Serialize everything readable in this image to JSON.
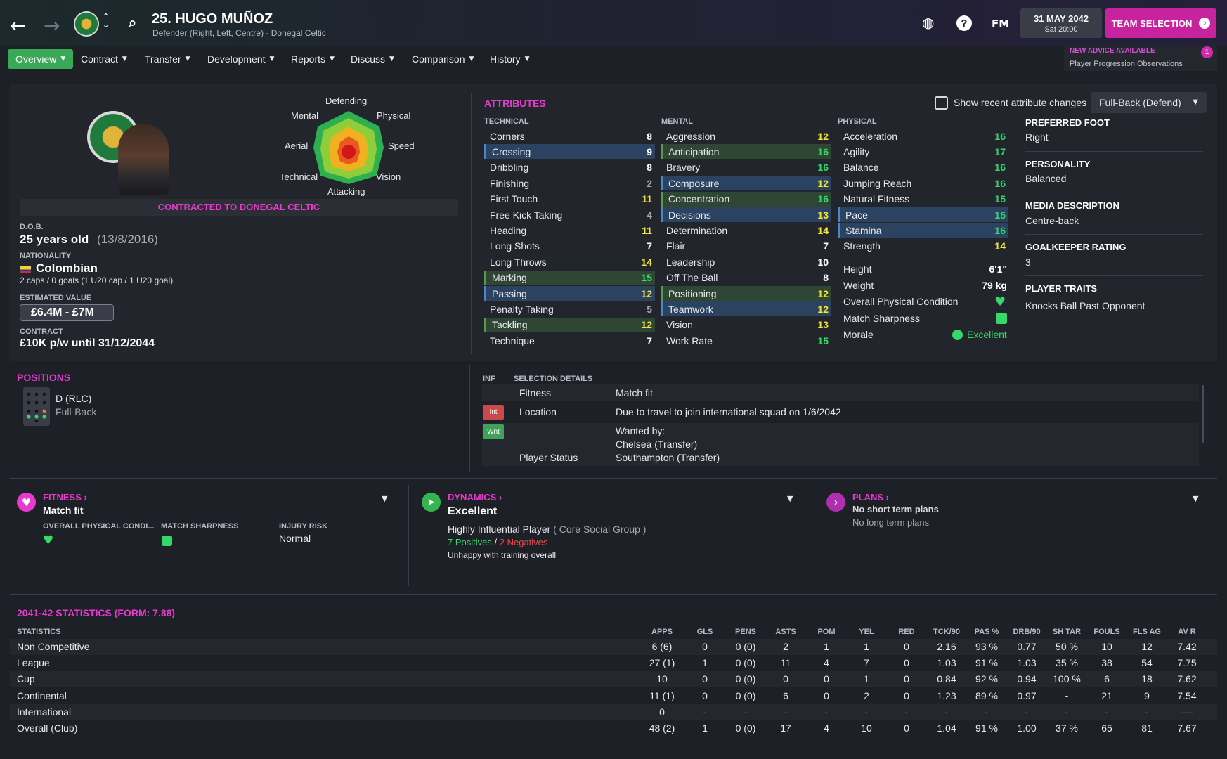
{
  "header": {
    "title": "25. HUGO MUÑOZ",
    "subtitle": "Defender (Right, Left, Centre) - Donegal Celtic",
    "fm_label": "FM",
    "date_main": "31 MAY 2042",
    "date_sub": "Sat 20:00",
    "team_selection": "TEAM SELECTION"
  },
  "tabs": [
    "Overview",
    "Contract",
    "Transfer",
    "Development",
    "Reports",
    "Discuss",
    "Comparison",
    "History"
  ],
  "advice": {
    "title": "NEW ADVICE AVAILABLE",
    "subtitle": "Player Progression Observations",
    "count": "1"
  },
  "profile": {
    "contracted": "CONTRACTED TO DONEGAL CELTIC",
    "dob_label": "D.O.B.",
    "dob_age": "25 years old",
    "dob_date": "(13/8/2016)",
    "nationality_label": "NATIONALITY",
    "nationality": "Colombian",
    "caps": "2 caps / 0 goals (1 U20 cap / 1 U20 goal)",
    "value_label": "ESTIMATED VALUE",
    "value": "£6.4M - £7M",
    "contract_label": "CONTRACT",
    "contract": "£10K p/w until 31/12/2044"
  },
  "radar": {
    "labels": [
      "Defending",
      "Physical",
      "Speed",
      "Vision",
      "Attacking",
      "Technical",
      "Aerial",
      "Mental"
    ]
  },
  "attributes": {
    "title": "ATTRIBUTES",
    "show_changes": "Show recent attribute changes",
    "role": "Full-Back (Defend)",
    "technical_label": "TECHNICAL",
    "mental_label": "MENTAL",
    "physical_label": "PHYSICAL",
    "technical": [
      {
        "name": "Corners",
        "value": "8"
      },
      {
        "name": "Crossing",
        "value": "9"
      },
      {
        "name": "Dribbling",
        "value": "8"
      },
      {
        "name": "Finishing",
        "value": "2"
      },
      {
        "name": "First Touch",
        "value": "11"
      },
      {
        "name": "Free Kick Taking",
        "value": "4"
      },
      {
        "name": "Heading",
        "value": "11"
      },
      {
        "name": "Long Shots",
        "value": "7"
      },
      {
        "name": "Long Throws",
        "value": "14"
      },
      {
        "name": "Marking",
        "value": "15"
      },
      {
        "name": "Passing",
        "value": "12"
      },
      {
        "name": "Penalty Taking",
        "value": "5"
      },
      {
        "name": "Tackling",
        "value": "12"
      },
      {
        "name": "Technique",
        "value": "7"
      }
    ],
    "mental": [
      {
        "name": "Aggression",
        "value": "12"
      },
      {
        "name": "Anticipation",
        "value": "16"
      },
      {
        "name": "Bravery",
        "value": "16"
      },
      {
        "name": "Composure",
        "value": "12"
      },
      {
        "name": "Concentration",
        "value": "16"
      },
      {
        "name": "Decisions",
        "value": "13"
      },
      {
        "name": "Determination",
        "value": "14"
      },
      {
        "name": "Flair",
        "value": "7"
      },
      {
        "name": "Leadership",
        "value": "10"
      },
      {
        "name": "Off The Ball",
        "value": "8"
      },
      {
        "name": "Positioning",
        "value": "12"
      },
      {
        "name": "Teamwork",
        "value": "12"
      },
      {
        "name": "Vision",
        "value": "13"
      },
      {
        "name": "Work Rate",
        "value": "15"
      }
    ],
    "physical": [
      {
        "name": "Acceleration",
        "value": "16"
      },
      {
        "name": "Agility",
        "value": "17"
      },
      {
        "name": "Balance",
        "value": "16"
      },
      {
        "name": "Jumping Reach",
        "value": "16"
      },
      {
        "name": "Natural Fitness",
        "value": "15"
      },
      {
        "name": "Pace",
        "value": "15"
      },
      {
        "name": "Stamina",
        "value": "16"
      },
      {
        "name": "Strength",
        "value": "14"
      }
    ],
    "height_label": "Height",
    "height": "6'1\"",
    "weight_label": "Weight",
    "weight": "79 kg",
    "opc_label": "Overall Physical Condition",
    "sharpness_label": "Match Sharpness",
    "morale_label": "Morale",
    "morale": "Excellent"
  },
  "side_info": {
    "foot_label": "PREFERRED FOOT",
    "foot": "Right",
    "personality_label": "PERSONALITY",
    "personality": "Balanced",
    "media_label": "MEDIA DESCRIPTION",
    "media": "Centre-back",
    "gk_label": "GOALKEEPER RATING",
    "gk": "3",
    "traits_label": "PLAYER TRAITS",
    "traits": "Knocks Ball Past Opponent"
  },
  "positions": {
    "title": "POSITIONS",
    "code": "D (RLC)",
    "role": "Full-Back"
  },
  "selection": {
    "inf_label": "INF",
    "title": "SELECTION DETAILS",
    "fitness_label": "Fitness",
    "fitness": "Match fit",
    "int_badge": "Int",
    "location_label": "Location",
    "location": "Due to travel to join international squad on 1/6/2042",
    "wnt_badge": "Wnt",
    "wanted_by": "Wanted by:",
    "wanted_1": "Chelsea (Transfer)",
    "status_label": "Player Status",
    "wanted_2": "Southampton (Transfer)"
  },
  "fitness_card": {
    "title": "FITNESS",
    "status": "Match fit",
    "opc_label": "OVERALL PHYSICAL CONDI...",
    "sharp_label": "MATCH SHARPNESS",
    "injury_label": "INJURY RISK",
    "injury": "Normal"
  },
  "dynamics_card": {
    "title": "DYNAMICS",
    "status": "Excellent",
    "influence": "Highly Influential Player",
    "group": "( Core Social Group )",
    "positives": "7 Positives",
    "slash": "/",
    "negatives": "2 Negatives",
    "training": "Unhappy with training overall"
  },
  "plans_card": {
    "title": "PLANS",
    "short": "No short term plans",
    "long": "No long term plans"
  },
  "stats": {
    "title": "2041-42 STATISTICS (FORM: 7.88)",
    "row_header": "STATISTICS",
    "columns": [
      "APPS",
      "GLS",
      "PENS",
      "ASTS",
      "POM",
      "YEL",
      "RED",
      "TCK/90",
      "PAS %",
      "DRB/90",
      "SH TAR",
      "FOULS",
      "FLS AG",
      "AV R"
    ],
    "rows": [
      {
        "label": "Non Competitive",
        "cells": [
          "6 (6)",
          "0",
          "0 (0)",
          "2",
          "1",
          "1",
          "0",
          "2.16",
          "93 %",
          "0.77",
          "50 %",
          "10",
          "12",
          "7.42"
        ]
      },
      {
        "label": "League",
        "cells": [
          "27 (1)",
          "1",
          "0 (0)",
          "11",
          "4",
          "7",
          "0",
          "1.03",
          "91 %",
          "1.03",
          "35 %",
          "38",
          "54",
          "7.75"
        ]
      },
      {
        "label": "Cup",
        "cells": [
          "10",
          "0",
          "0 (0)",
          "0",
          "0",
          "1",
          "0",
          "0.84",
          "92 %",
          "0.94",
          "100 %",
          "6",
          "18",
          "7.62"
        ]
      },
      {
        "label": "Continental",
        "cells": [
          "11 (1)",
          "0",
          "0 (0)",
          "6",
          "0",
          "2",
          "0",
          "1.23",
          "89 %",
          "0.97",
          "-",
          "21",
          "9",
          "7.54"
        ]
      },
      {
        "label": "International",
        "cells": [
          "0",
          "-",
          "-",
          "-",
          "-",
          "-",
          "-",
          "-",
          "-",
          "-",
          "-",
          "-",
          "-",
          "----"
        ]
      },
      {
        "label": "Overall (Club)",
        "cells": [
          "48 (2)",
          "1",
          "0 (0)",
          "17",
          "4",
          "10",
          "0",
          "1.04",
          "91 %",
          "1.00",
          "37 %",
          "65",
          "81",
          "7.67"
        ]
      }
    ]
  },
  "colors": {
    "accent": "#e93ad0",
    "tab_active": "#39a857",
    "team_btn": "#c7239e",
    "high_value": "#35d96a",
    "mid_value": "#f2e43a"
  }
}
